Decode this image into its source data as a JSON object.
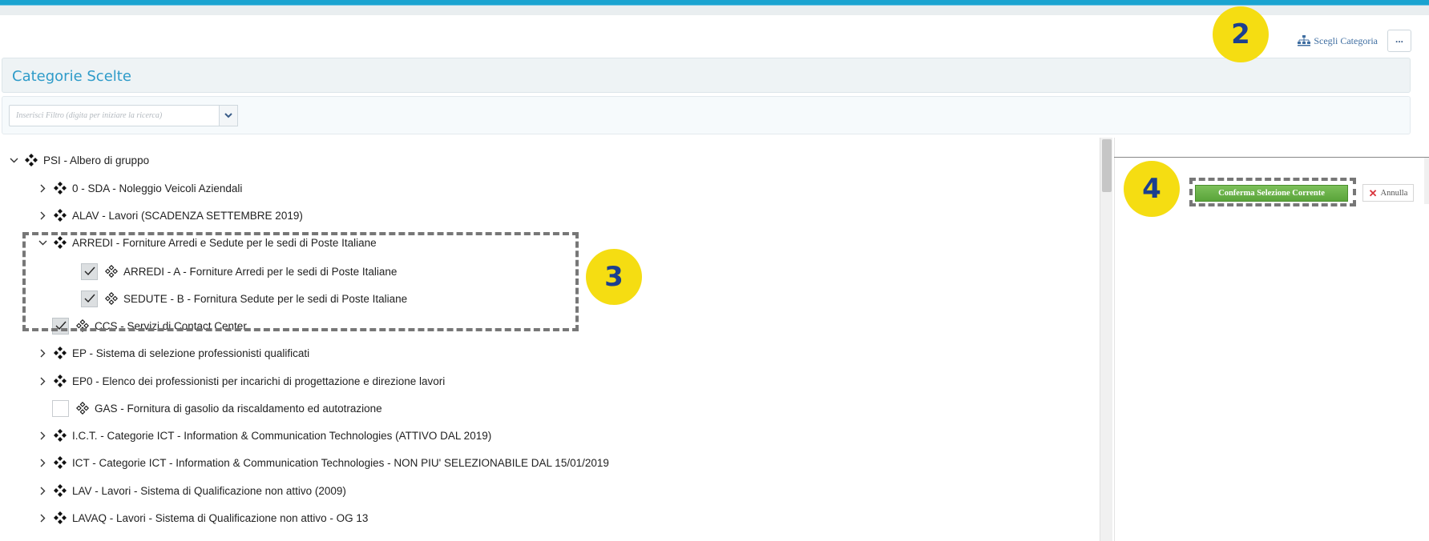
{
  "header": {
    "choose_category_label": "Scegli Categoria",
    "more_label": "..."
  },
  "panel": {
    "title": "Categorie Scelte"
  },
  "filter": {
    "placeholder": "Inserisci Filtro (digita per iniziare la ricerca)"
  },
  "tree": {
    "root": {
      "label": "PSI - Albero di gruppo",
      "expanded": true
    },
    "items": [
      {
        "label": "0 - SDA - Noleggio Veicoli Aziendali",
        "type": "folder",
        "expanded": false
      },
      {
        "label": "ALAV - Lavori (SCADENZA SETTEMBRE 2019)",
        "type": "folder",
        "expanded": false
      },
      {
        "label": "ARREDI - Forniture Arredi e Sedute per le sedi di Poste Italiane",
        "type": "folder",
        "expanded": true
      },
      {
        "label": "ARREDI - A - Forniture Arredi per le sedi di Poste Italiane",
        "type": "leaf",
        "checked": true
      },
      {
        "label": "SEDUTE - B - Fornitura Sedute per le sedi di Poste Italiane",
        "type": "leaf",
        "checked": true
      },
      {
        "label": "CCS - Servizi di Contact Center",
        "type": "leaf",
        "checked": true
      },
      {
        "label": "EP - Sistema di selezione professionisti qualificati",
        "type": "folder",
        "expanded": false
      },
      {
        "label": "EP0 - Elenco dei professionisti per incarichi di progettazione e direzione lavori",
        "type": "folder",
        "expanded": false
      },
      {
        "label": "GAS - Fornitura di gasolio da riscaldamento ed autotrazione",
        "type": "leaf",
        "checked": false
      },
      {
        "label": "I.C.T. - Categorie ICT - Information & Communication Technologies (ATTIVO DAL 2019)",
        "type": "folder",
        "expanded": false
      },
      {
        "label": "ICT - Categorie ICT - Information & Communication Technologies - NON PIU' SELEZIONABILE DAL 15/01/2019",
        "type": "folder",
        "expanded": false
      },
      {
        "label": "LAV - Lavori - Sistema di Qualificazione non attivo (2009)",
        "type": "folder",
        "expanded": false
      },
      {
        "label": "LAVAQ - Lavori - Sistema di Qualificazione non attivo - OG 13",
        "type": "folder",
        "expanded": false
      }
    ]
  },
  "actions": {
    "confirm_label": "Conferma Selezione Corrente",
    "cancel_label": "Annulla"
  },
  "badges": {
    "b2": "2",
    "b3": "3",
    "b4": "4"
  },
  "colors": {
    "accent": "#1aa3d0",
    "title": "#2e9bc9",
    "confirm": "#5aa43a",
    "badge": "#f5dd12",
    "badge_text": "#1b3f8f"
  }
}
